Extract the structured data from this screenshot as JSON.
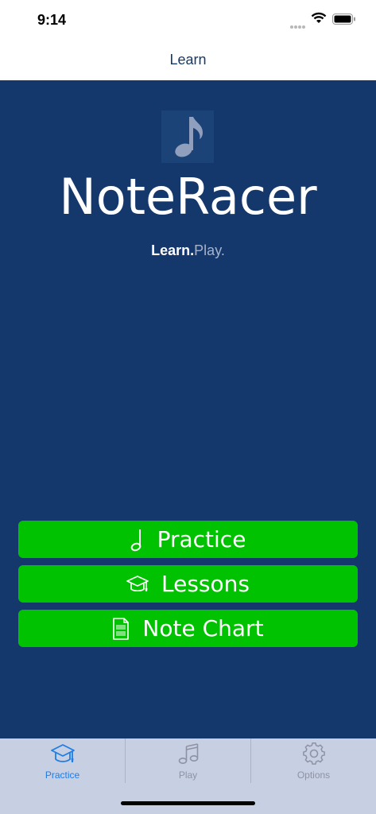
{
  "status_bar": {
    "time": "9:14"
  },
  "nav": {
    "title": "Learn"
  },
  "hero": {
    "logo_icon": "eighth-note-icon",
    "app_name": "NoteRacer",
    "tagline_bold": "Learn.",
    "tagline_light": "Play."
  },
  "buttons": [
    {
      "label": "Practice",
      "icon": "half-note-icon"
    },
    {
      "label": "Lessons",
      "icon": "graduation-cap-icon"
    },
    {
      "label": "Note Chart",
      "icon": "sheet-document-icon"
    }
  ],
  "tab_bar": {
    "tabs": [
      {
        "label": "Practice",
        "icon": "graduation-cap-icon",
        "selected": true
      },
      {
        "label": "Play",
        "icon": "music-notes-icon",
        "selected": false
      },
      {
        "label": "Options",
        "icon": "gear-icon",
        "selected": false
      }
    ]
  },
  "colors": {
    "background": "#14376c",
    "button": "#00c200",
    "tab_bar": "#c7cfe3",
    "tab_selected": "#1f7de6",
    "nav_title": "#13396d"
  }
}
